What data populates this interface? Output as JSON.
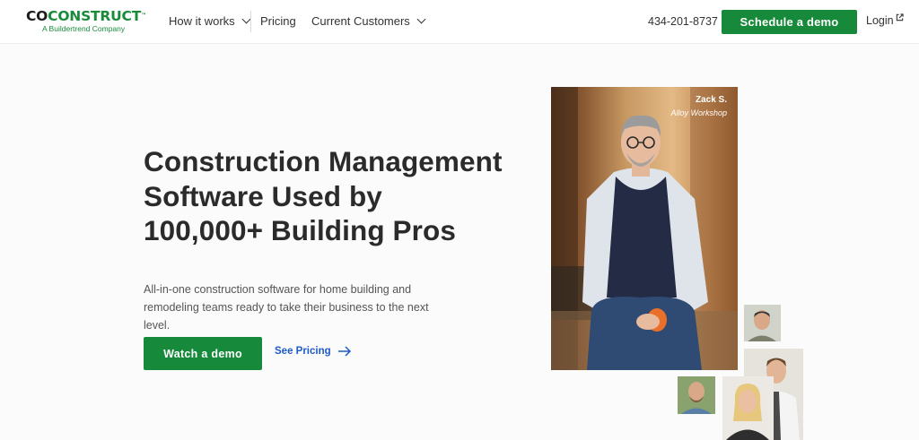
{
  "brand": {
    "logo_co": "CO",
    "logo_rest": "CONSTRUCT",
    "tm": "™",
    "tagline": "A Buildertrend Company"
  },
  "nav": {
    "items": [
      {
        "label": "How it works",
        "has_dropdown": true
      },
      {
        "label": "Pricing",
        "has_dropdown": false
      },
      {
        "label": "Current Customers",
        "has_dropdown": true
      }
    ],
    "phone": "434-201-8737",
    "schedule_label": "Schedule a demo",
    "login_label": "Login"
  },
  "hero": {
    "headline_line1": "Construction Management",
    "headline_line2": "Software Used by",
    "headline_line3": "100,000+ Building Pros",
    "subtext_line1": "All-in-one construction software for home building and",
    "subtext_line2": "remodeling teams ready to take their business to the next level.",
    "watch_label": "Watch a demo",
    "pricing_label": "See Pricing"
  },
  "testimonial": {
    "name": "Zack S.",
    "company": "Alloy Workshop"
  },
  "colors": {
    "brand_green": "#168a3a",
    "link_blue": "#1f5bc6",
    "text_dark": "#2b2b2b"
  },
  "icons": [
    "chevron-down-icon",
    "external-link-icon",
    "arrow-right-icon"
  ]
}
